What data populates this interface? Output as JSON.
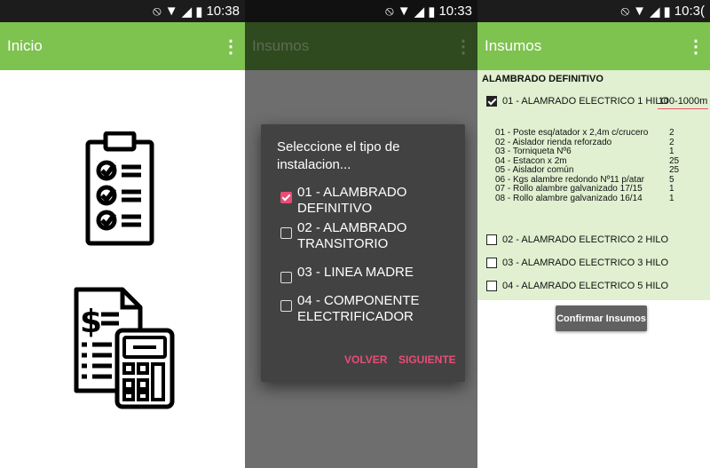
{
  "screens": [
    {
      "status": {
        "time": "10:38"
      },
      "appbar": {
        "title": "Inicio",
        "menu_icon": "more-vert-icon"
      },
      "icons": [
        "checklist-icon",
        "budget-calculator-icon"
      ]
    },
    {
      "status": {
        "time": "10:33"
      },
      "appbar": {
        "title": "Insumos",
        "menu_icon": "more-vert-icon"
      },
      "dialog": {
        "title": "Seleccione el tipo de instalacion...",
        "options": [
          {
            "label": "01 - ALAMBRADO DEFINITIVO",
            "checked": true
          },
          {
            "label": "02 - ALAMBRADO TRANSITORIO",
            "checked": false
          },
          {
            "label": "03 - LINEA MADRE",
            "checked": false
          },
          {
            "label": "04 - COMPONENTE ELECTRIFICADOR",
            "checked": false
          }
        ],
        "back_label": "VOLVER",
        "next_label": "SIGUIENTE"
      }
    },
    {
      "status": {
        "time": "10:3("
      },
      "appbar": {
        "title": "Insumos",
        "menu_icon": "more-vert-icon"
      },
      "section_title": "ALAMBRADO DEFINITIVO",
      "options": [
        {
          "label": "01 - ALAMRADO ELECTRICO 1 HILO",
          "checked": true,
          "range": "100-1000m"
        },
        {
          "label": "02 - ALAMRADO ELECTRICO 2 HILO",
          "checked": false
        },
        {
          "label": "03 - ALAMRADO ELECTRICO 3 HILO",
          "checked": false
        },
        {
          "label": "04 - ALAMRADO ELECTRICO 5 HILO",
          "checked": false
        }
      ],
      "items": [
        {
          "name": "01 - Poste esq/atador x  2,4m c/crucero",
          "qty": "2"
        },
        {
          "name": "02 - Aislador rienda reforzado",
          "qty": "2"
        },
        {
          "name": "03 - Torniqueta Nº6",
          "qty": "1"
        },
        {
          "name": "04 - Estacon x 2m",
          "qty": "25"
        },
        {
          "name": "05 - Aislador común",
          "qty": "25"
        },
        {
          "name": "06 - Kgs alambre redondo Nº11 p/atar",
          "qty": "5"
        },
        {
          "name": "07 - Rollo alambre galvanizado 17/15",
          "qty": "1"
        },
        {
          "name": "08 - Rollo alambre galvanizado 16/14",
          "qty": "1"
        }
      ],
      "confirm_label": "Confirmar Insumos"
    }
  ],
  "colors": {
    "green": "#7ec250",
    "accent": "#e84d77",
    "dialog": "#424242",
    "content_bg": "#e0f0d0"
  }
}
